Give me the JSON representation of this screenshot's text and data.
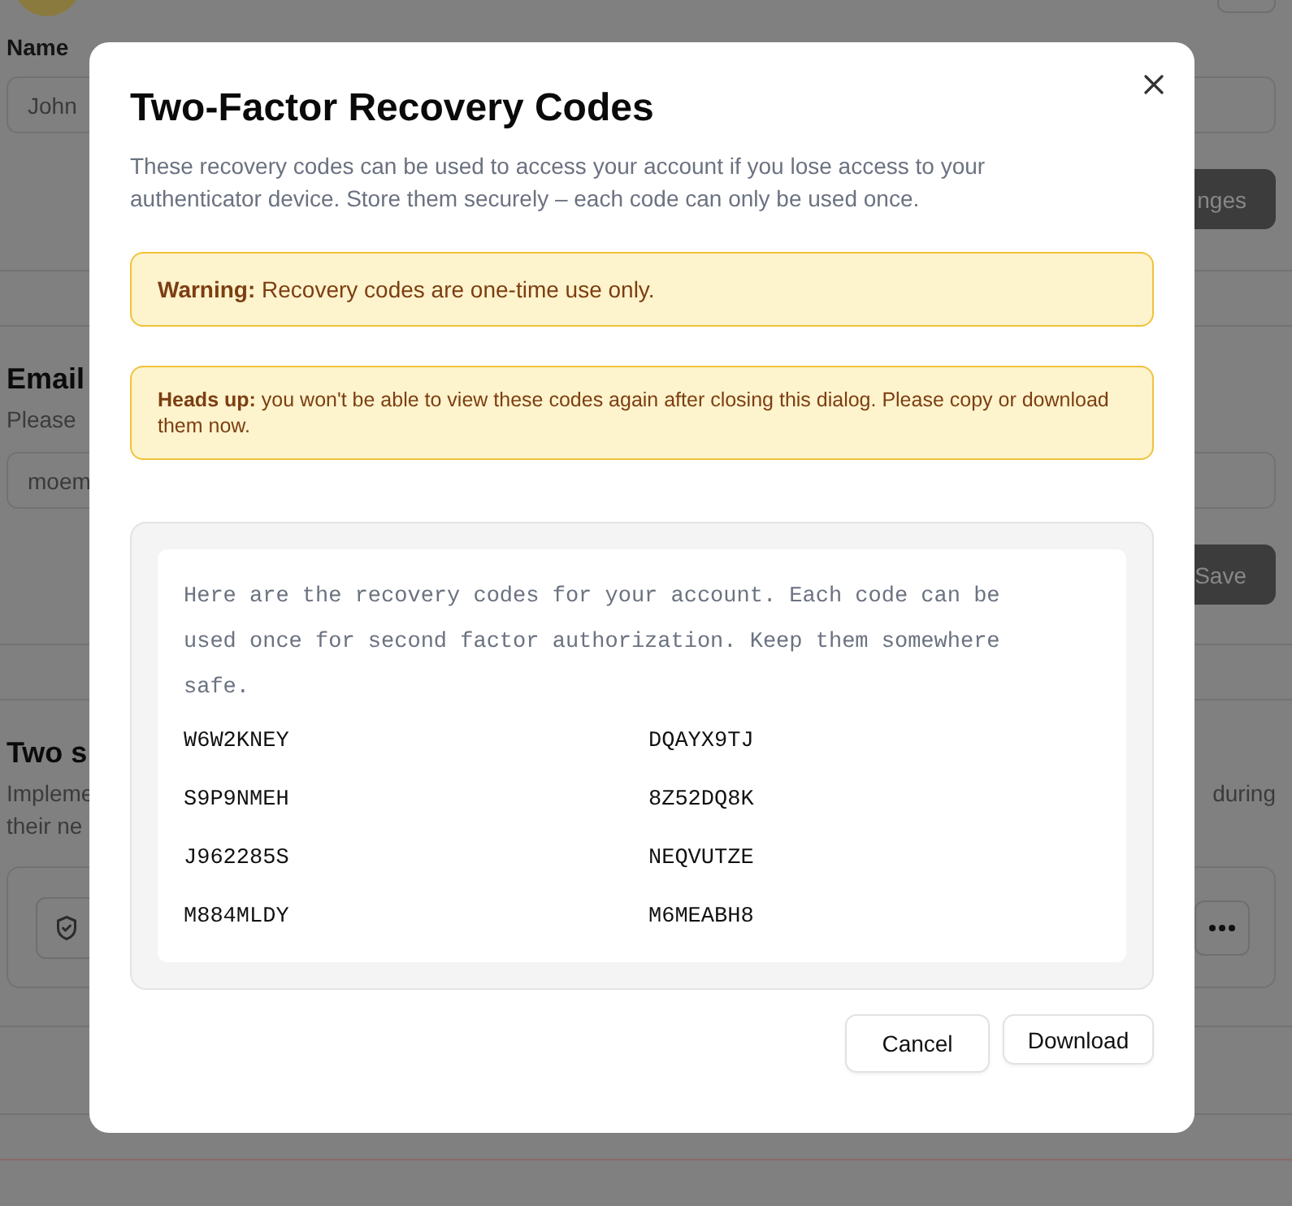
{
  "background_page": {
    "name_label": "Name",
    "name_value": "John",
    "save_changes_button": "nges",
    "email_heading": "Email",
    "email_hint": "Please",
    "email_value": "moem",
    "save_button": "Save",
    "two_step_heading": "Two s",
    "two_step_text_lines": [
      "Impleme",
      "their ne"
    ],
    "two_step_text_right": "during"
  },
  "dialog": {
    "title": "Two-Factor Recovery Codes",
    "description": "These recovery codes can be used to access your account if you lose access to your authenticator device. Store them securely – each code can only be used once.",
    "alerts": [
      {
        "kind": "warning",
        "text": "**Warning:** Recovery codes are one-time use only."
      },
      {
        "kind": "notice",
        "text": "**Heads up:** you won't be able to view these codes again after closing this dialog. Please copy or download them now."
      }
    ],
    "codes_intro": "Here are the recovery codes for your account. Each code can be used once for second factor authorization. Keep them somewhere safe.",
    "codes": [
      "W6W2KNEY",
      "DQAYX9TJ",
      "S9P9NMEH",
      "8Z52DQ8K",
      "J962285S",
      "NEQVUTZE",
      "M884MLDY",
      "M6MEABH8"
    ],
    "buttons": [
      {
        "kind": "secondary",
        "label": "Cancel"
      },
      {
        "kind": "primary",
        "label": "Download"
      }
    ]
  }
}
